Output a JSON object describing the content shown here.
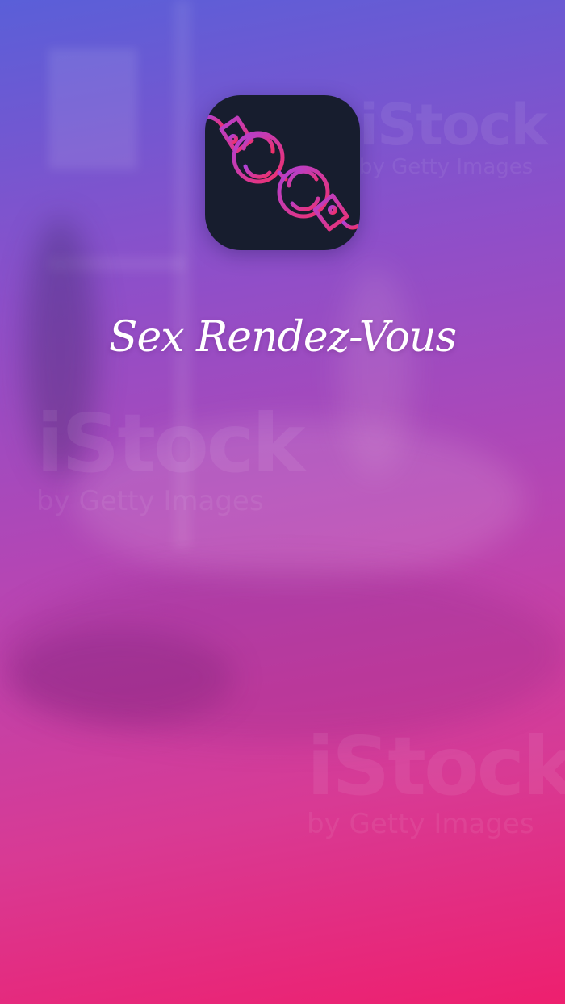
{
  "app": {
    "title": "Sex Rendez-Vous",
    "logo_icon": "handcuffs-icon"
  },
  "background": {
    "gradient_top": "#5a5fd8",
    "gradient_bottom": "#ee1f6e",
    "watermarks": [
      {
        "main": "iStock",
        "sub": "by Getty Images"
      },
      {
        "main": "iStock",
        "sub": "by Getty Images"
      },
      {
        "main": "iStock",
        "sub": "by Getty Images"
      }
    ]
  },
  "colors": {
    "icon_background": "#171d2e",
    "icon_gradient_start": "#b041d6",
    "icon_gradient_end": "#f0306a",
    "title_text": "#ffffff"
  }
}
